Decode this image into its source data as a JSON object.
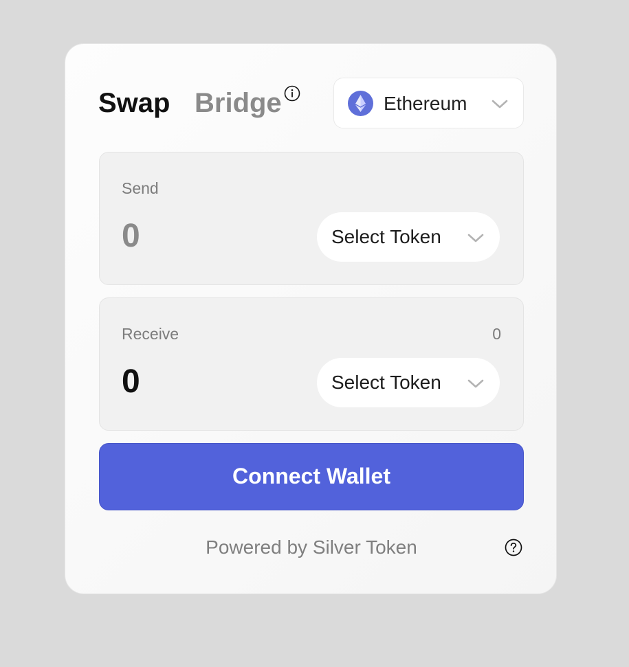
{
  "tabs": {
    "swap": "Swap",
    "bridge": "Bridge"
  },
  "network": {
    "label": "Ethereum",
    "icon": "ethereum-icon"
  },
  "send": {
    "label": "Send",
    "amount": "0",
    "token_label": "Select Token"
  },
  "receive": {
    "label": "Receive",
    "balance": "0",
    "amount": "0",
    "token_label": "Select Token"
  },
  "connect_button": "Connect Wallet",
  "footer": {
    "powered_by": "Powered by Silver Token",
    "help_icon": "question-circle-icon"
  },
  "colors": {
    "accent": "#5262db",
    "background": "#dadada",
    "card": "#fafafa",
    "panel": "#f1f1f1",
    "muted_text": "#8a8a8a",
    "primary_text": "#111111",
    "ethereum_badge": "#5f6fd9"
  }
}
